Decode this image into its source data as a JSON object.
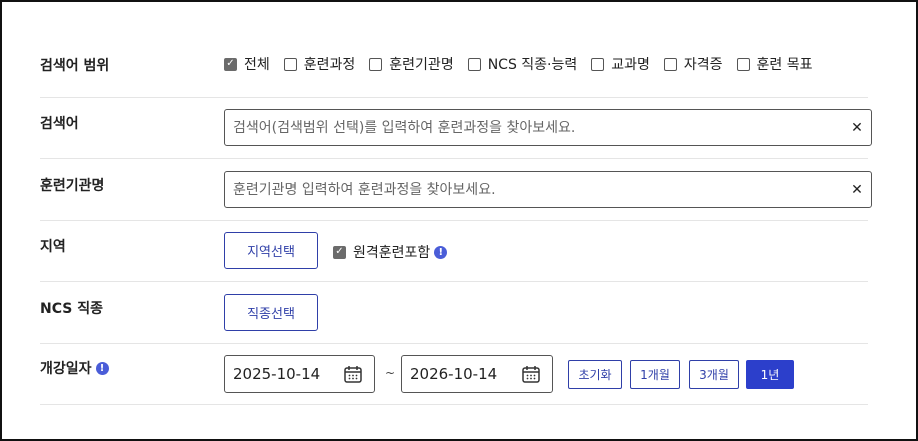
{
  "scope": {
    "label": "검색어 범위",
    "options": [
      {
        "label": "전체",
        "checked": true
      },
      {
        "label": "훈련과정",
        "checked": false
      },
      {
        "label": "훈련기관명",
        "checked": false
      },
      {
        "label": "NCS 직종·능력",
        "checked": false
      },
      {
        "label": "교과명",
        "checked": false
      },
      {
        "label": "자격증",
        "checked": false
      },
      {
        "label": "훈련 목표",
        "checked": false
      }
    ]
  },
  "keyword": {
    "label": "검색어",
    "placeholder": "검색어(검색범위 선택)를 입력하여 훈련과정을 찾아보세요.",
    "value": ""
  },
  "institution": {
    "label": "훈련기관명",
    "placeholder": "훈련기관명 입력하여 훈련과정을 찾아보세요.",
    "value": ""
  },
  "region": {
    "label": "지역",
    "button": "지역선택",
    "remote_label": "원격훈련포함",
    "remote_checked": true
  },
  "ncs": {
    "label": "NCS 직종",
    "button": "직종선택"
  },
  "date": {
    "label": "개강일자",
    "start": "2025-10-14",
    "end": "2026-10-14",
    "separator": "~",
    "buttons": [
      "초기화",
      "1개월",
      "3개월",
      "1년"
    ],
    "active_button": "1년"
  },
  "icons": {
    "info": "info-icon",
    "calendar": "calendar-icon",
    "clear": "clear-icon",
    "check": "check-icon"
  },
  "colors": {
    "accent": "#2c3fcb",
    "info": "#4a5dd8",
    "checkbox_checked": "#6b6b6b"
  }
}
